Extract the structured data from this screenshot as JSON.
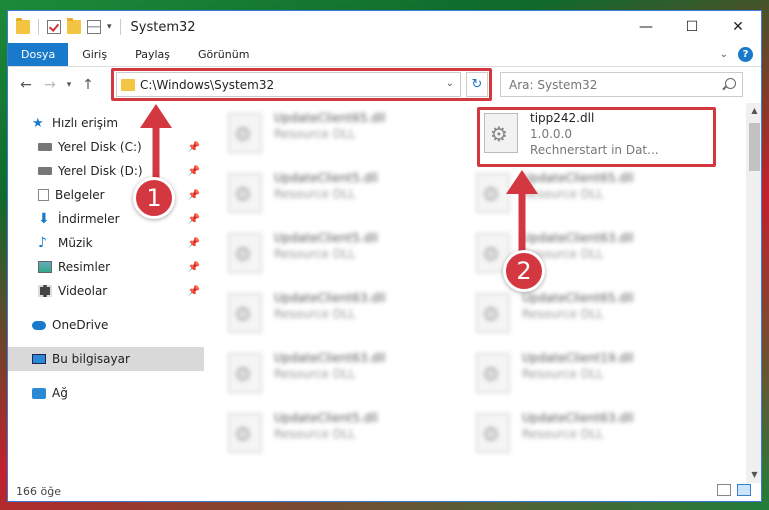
{
  "window": {
    "title": "System32"
  },
  "window_controls": {
    "minimize": "—",
    "maximize": "☐",
    "close": "✕"
  },
  "ribbon": {
    "tabs": [
      "Dosya",
      "Giriş",
      "Paylaş",
      "Görünüm"
    ]
  },
  "navigation": {
    "address": "C:\\Windows\\System32",
    "search_placeholder": "Ara: System32"
  },
  "sidebar": {
    "quick_access": "Hızlı erişim",
    "items": [
      "Yerel Disk (C:)",
      "Yerel Disk (D:)",
      "Belgeler",
      "İndirmeler",
      "Müzik",
      "Resimler",
      "Videolar"
    ],
    "onedrive": "OneDrive",
    "this_pc": "Bu bilgisayar",
    "network": "Ağ"
  },
  "files": {
    "highlighted": {
      "name": "tipp242.dll",
      "version": "1.0.0.0",
      "description": "Rechnerstart in Dat..."
    },
    "left_column": [
      {
        "name": "UpdateClient65.dll",
        "type": "Resource DLL"
      },
      {
        "name": "UpdateClient5.dll",
        "type": "Resource DLL"
      },
      {
        "name": "UpdateClient5.dll",
        "type": "Resource DLL"
      },
      {
        "name": "UpdateClient63.dll",
        "type": "Resource DLL"
      },
      {
        "name": "UpdateClient63.dll",
        "type": "Resource DLL"
      },
      {
        "name": "UpdateClient5.dll",
        "type": "Resource DLL"
      }
    ],
    "right_column": [
      {
        "name": "UpdateClient65.dll",
        "type": "Resource DLL"
      },
      {
        "name": "UpdateClient63.dll",
        "type": "Resource DLL"
      },
      {
        "name": "UpdateClient65.dll",
        "type": "Resource DLL"
      },
      {
        "name": "UpdateClient19.dll",
        "type": "Resource DLL"
      },
      {
        "name": "UpdateClient63.dll",
        "type": "Resource DLL"
      }
    ]
  },
  "status": {
    "item_count": "166 öğe"
  },
  "markers": {
    "one": "1",
    "two": "2"
  },
  "colors": {
    "accent": "#1979ca",
    "highlight": "#d3373f"
  }
}
